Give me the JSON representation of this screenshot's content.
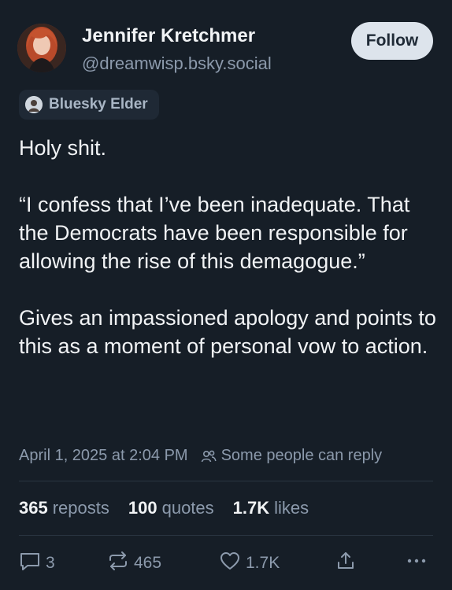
{
  "author": {
    "name": "Jennifer Kretchmer",
    "handle": "@dreamwisp.bsky.social"
  },
  "follow_label": "Follow",
  "badge": {
    "label": "Bluesky Elder"
  },
  "post": {
    "paragraphs": [
      "Holy shit.",
      "“I confess that I’ve been inadequate. That the Democrats have been responsible for allowing the rise of this demagogue.”",
      "Gives an impassioned apology and points to this as a moment of personal vow to action."
    ],
    "timestamp": "April 1, 2025 at 2:04 PM",
    "reply_setting": "Some people can reply"
  },
  "stats": {
    "reposts_count": "365",
    "reposts_label": "reposts",
    "quotes_count": "100",
    "quotes_label": "quotes",
    "likes_count": "1.7K",
    "likes_label": "likes"
  },
  "actions": {
    "replies": "3",
    "reposts": "465",
    "likes": "1.7K"
  },
  "icons": {
    "reply": "speech-bubble-icon",
    "repost": "repost-arrows-icon",
    "like": "heart-icon",
    "share": "share-upload-icon",
    "more": "ellipsis-icon",
    "people": "people-icon"
  },
  "colors": {
    "background": "#161e27",
    "text_primary": "#f1f3f5",
    "text_secondary": "#8c9aac",
    "follow_button_bg": "#dde4ec",
    "badge_bg": "#1f2935"
  }
}
